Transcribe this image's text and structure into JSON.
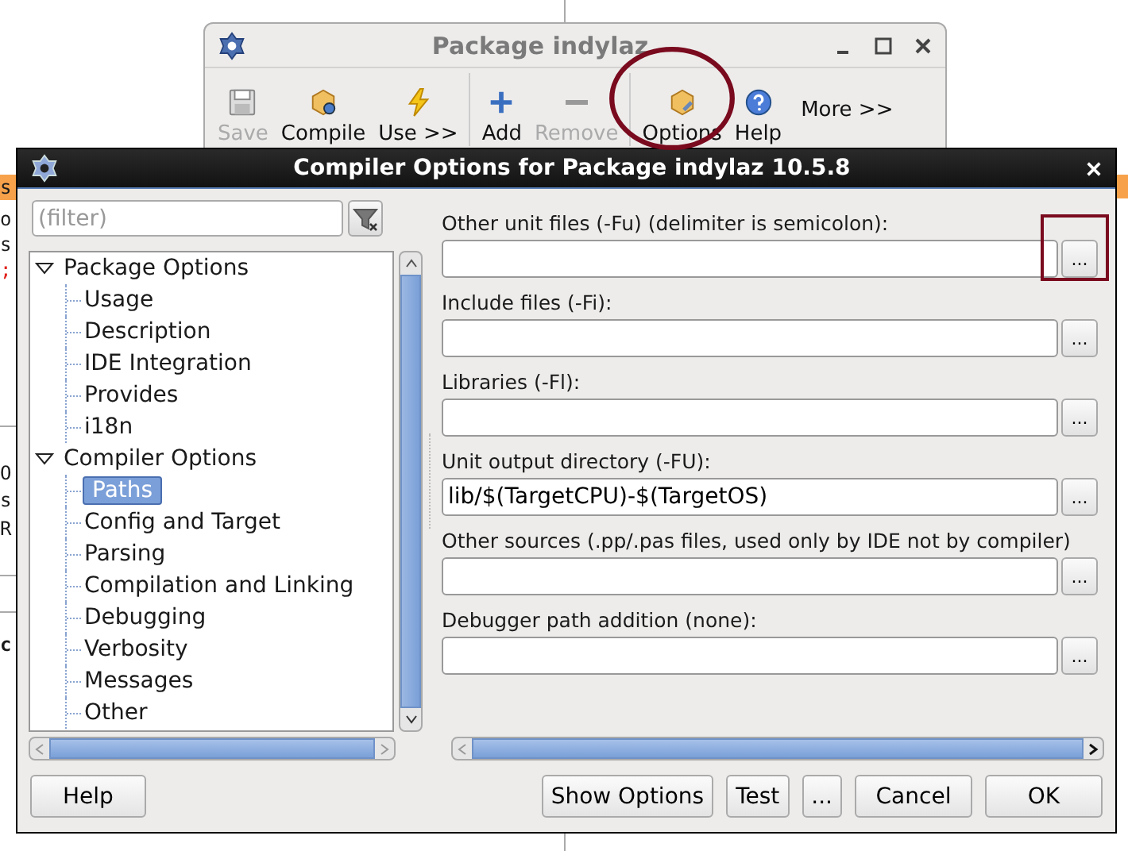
{
  "background_editor": {
    "fragments": [
      {
        "text": "s",
        "kind": "tab"
      },
      {
        "text": "o",
        "kind": "code"
      },
      {
        "text": "s",
        "kind": "code"
      },
      {
        "text": ";",
        "kind": "symbol"
      },
      {
        "text": "O",
        "kind": "code"
      },
      {
        "text": "s",
        "kind": "code"
      },
      {
        "text": "R",
        "kind": "code"
      },
      {
        "text": "c",
        "kind": "bold"
      }
    ]
  },
  "package_window": {
    "title": "Package indylaz",
    "toolbar": [
      {
        "kind": "save",
        "label": "Save",
        "disabled": true
      },
      {
        "kind": "compile",
        "label": "Compile",
        "disabled": false
      },
      {
        "kind": "use",
        "label": "Use >>",
        "disabled": false
      },
      {
        "kind": "separator"
      },
      {
        "kind": "add",
        "label": "Add",
        "disabled": false
      },
      {
        "kind": "remove",
        "label": "Remove",
        "disabled": true
      },
      {
        "kind": "separator"
      },
      {
        "kind": "options",
        "label": "Options",
        "disabled": false
      },
      {
        "kind": "help",
        "label": "Help",
        "disabled": false
      },
      {
        "kind": "more",
        "label": "More >>",
        "disabled": false
      }
    ]
  },
  "dialog": {
    "title": "Compiler Options for Package indylaz 10.5.8",
    "filter": {
      "placeholder": "(filter)"
    },
    "tree": [
      {
        "label": "Package Options",
        "expanded": true,
        "selected": false,
        "children": [
          {
            "label": "Usage",
            "selected": false
          },
          {
            "label": "Description",
            "selected": false
          },
          {
            "label": "IDE Integration",
            "selected": false
          },
          {
            "label": "Provides",
            "selected": false
          },
          {
            "label": "i18n",
            "selected": false
          }
        ]
      },
      {
        "label": "Compiler Options",
        "expanded": true,
        "selected": false,
        "children": [
          {
            "label": "Paths",
            "selected": true
          },
          {
            "label": "Config and Target",
            "selected": false
          },
          {
            "label": "Parsing",
            "selected": false
          },
          {
            "label": "Compilation and Linking",
            "selected": false
          },
          {
            "label": "Debugging",
            "selected": false
          },
          {
            "label": "Verbosity",
            "selected": false
          },
          {
            "label": "Messages",
            "selected": false
          },
          {
            "label": "Other",
            "selected": false
          }
        ]
      }
    ],
    "fields": [
      {
        "label": "Other unit files (-Fu) (delimiter is semicolon):",
        "browse": "..."
      },
      {
        "label": "Include files (-Fi):",
        "browse": "..."
      },
      {
        "label": "Libraries (-Fl):",
        "browse": "..."
      },
      {
        "label": "Unit output directory (-FU):",
        "value": "lib/$(TargetCPU)-$(TargetOS)",
        "browse": "..."
      },
      {
        "label": "Other sources (.pp/.pas files, used only by IDE not by compiler)",
        "browse": "..."
      },
      {
        "label": "Debugger path addition (none):",
        "browse": "..."
      }
    ],
    "buttons_left": [
      "Help"
    ],
    "buttons_right": [
      "Show Options",
      "Test",
      "...",
      "Cancel",
      "OK"
    ]
  },
  "annotations": [
    {
      "kind": "ellipse",
      "color": "#7a0a1e"
    },
    {
      "kind": "rectangle",
      "color": "#7a0a1e"
    }
  ]
}
